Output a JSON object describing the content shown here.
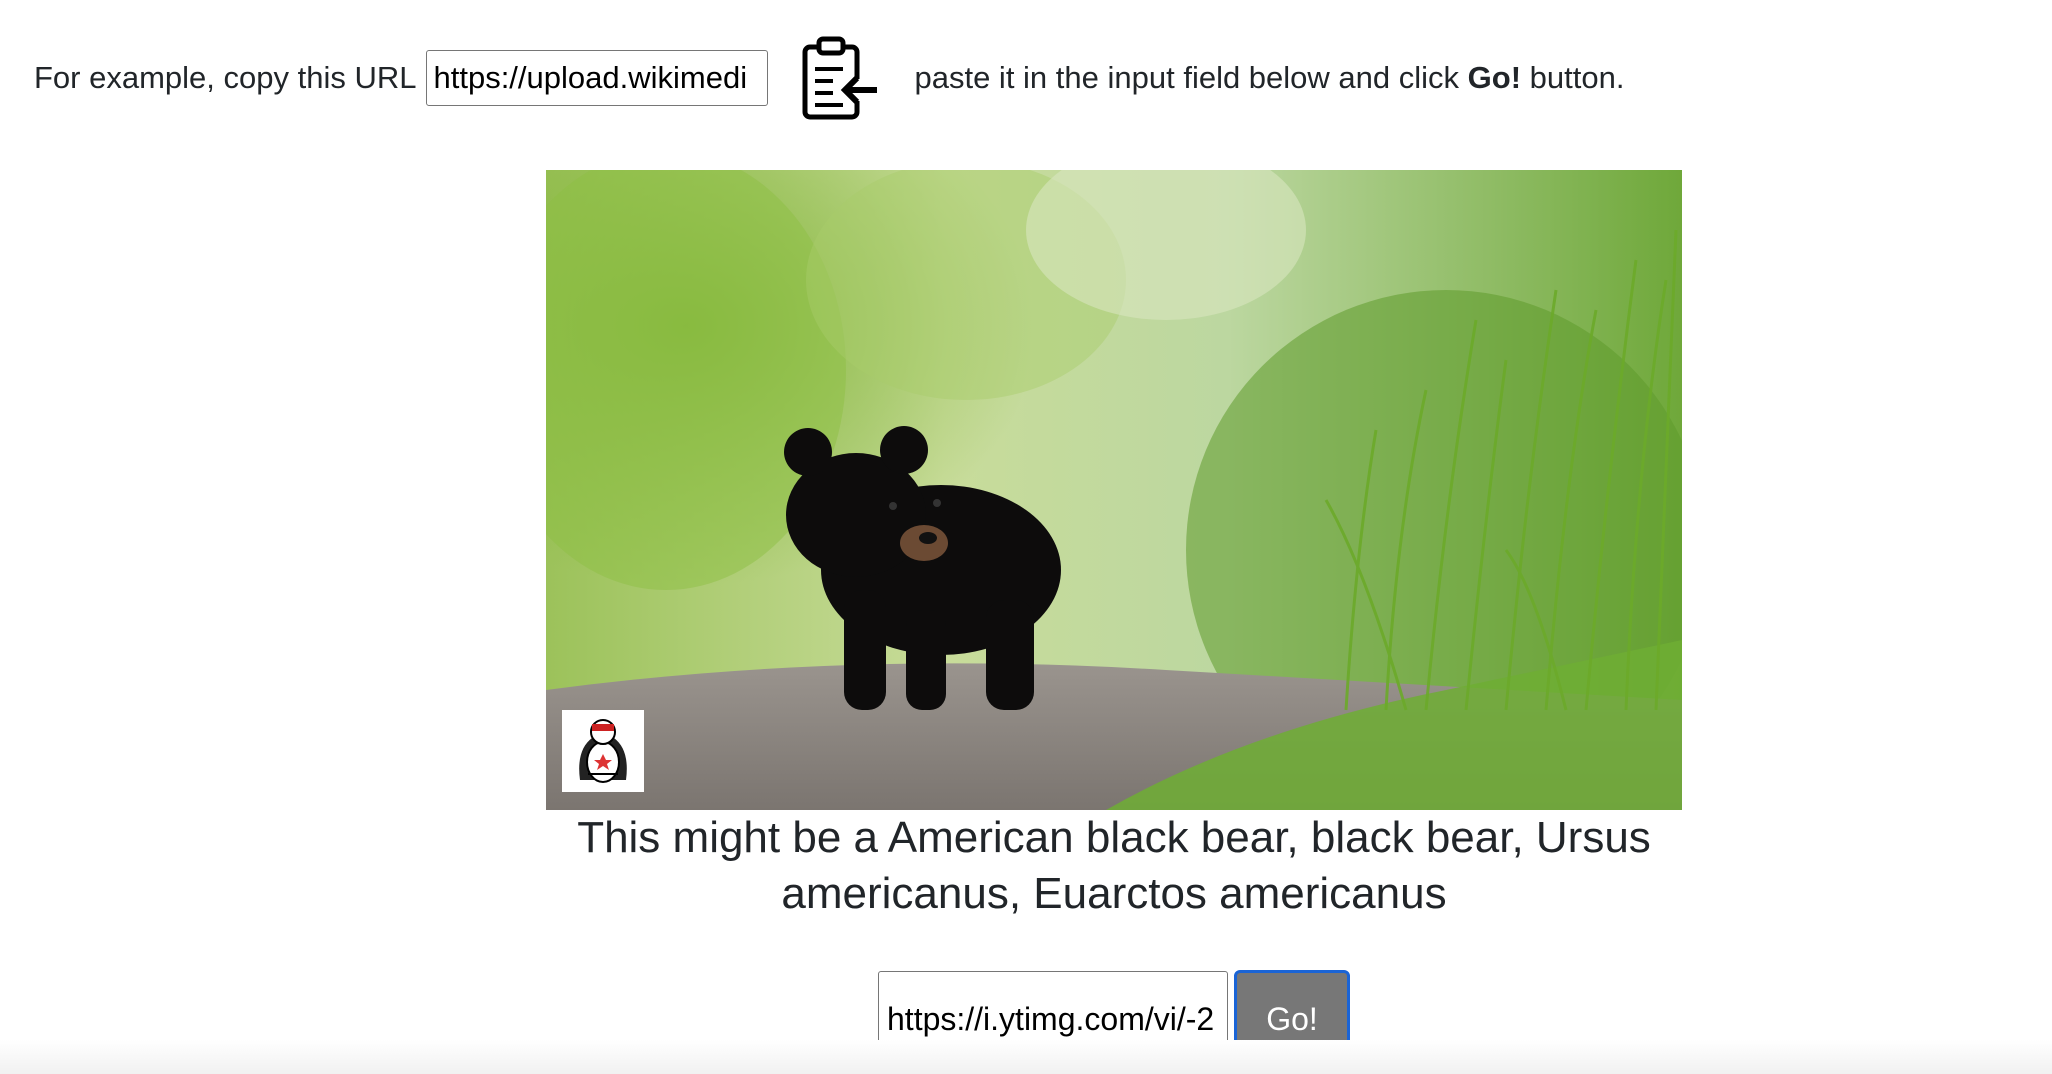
{
  "instructions": {
    "lead": "For example, copy this URL",
    "example_url": "https://upload.wikimedi",
    "clipboard_icon": "clipboard-paste-icon",
    "paste_before": "paste it in the input field below and click",
    "paste_bold": "Go!",
    "paste_after": "button."
  },
  "photo": {
    "subject": "bear-cub-photo",
    "watermark_icon": "mascot-logo"
  },
  "result": {
    "line1": "This might be a American black bear, black bear, Ursus",
    "line2": "americanus, Euarctos americanus"
  },
  "form": {
    "url_value": "https://i.ytimg.com/vi/-2",
    "go_label": "Go!"
  },
  "colors": {
    "go_bg": "#777777",
    "go_border": "#1a64d6",
    "text": "#212529"
  }
}
